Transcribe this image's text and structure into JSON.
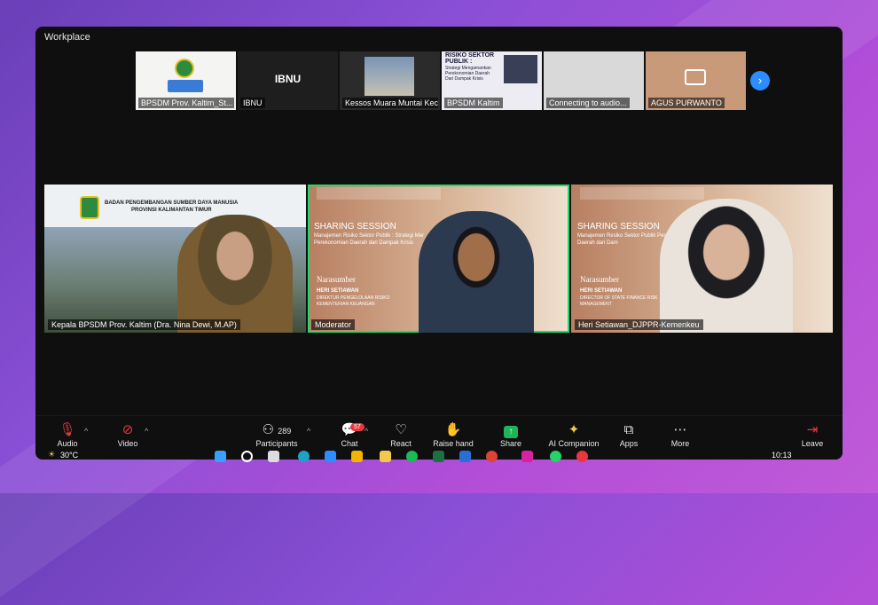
{
  "window": {
    "title": "Workplace",
    "status_right": ""
  },
  "thumbnails": [
    {
      "name": "BPSDM Prov. Kaltim_St...",
      "center_label": ""
    },
    {
      "name": "IBNU",
      "center_label": "IBNU"
    },
    {
      "name": "Kessos Muara Muntai Kec...",
      "center_label": ""
    },
    {
      "name": "BPSDM Kaltim",
      "center_label": ""
    },
    {
      "name": "Connecting to audio...",
      "center_label": ""
    },
    {
      "name": "AGUS PURWANTO",
      "center_label": ""
    }
  ],
  "thumb_slide": {
    "heading": "RISIKO SEKTOR PUBLIK :",
    "sub": "Strategi Mengamankan Perekonomian Daerah Dari Dampak Krisis"
  },
  "tiles": [
    {
      "name": "Kepala BPSDM Prov. Kaltim (Dra. Nina Dewi, M.AP)",
      "banner1": "BADAN PENGEMBANGAN SUMBER DAYA MANUSIA",
      "banner2": "PROVINSI KALIMANTAN TIMUR"
    },
    {
      "name": "Moderator",
      "session": "SHARING SESSION",
      "topic": "Manajemen Risiko Sektor Publik : Strategi Mer Perekonomian Daerah dari Dampak Krisis",
      "speaker_heading": "Narasumber",
      "speaker_name": "HERI SETIAWAN",
      "speaker_role": "DIREKTUR PENGELOLAAN RISIKO KEMENTERIAN KEUANGAN"
    },
    {
      "name": "Heri Setiawan_DJPPR-Kemenkeu",
      "session": "SHARING SESSION",
      "topic": "Manajemen Resiko Sektor Publik Perekonomian Daerah dari Dam",
      "speaker_heading": "Narasumber",
      "speaker_name": "HERI SETIAWAN",
      "speaker_role": "DIRECTOR OF STATE FINANCE RISK MANAGEMENT"
    }
  ],
  "toolbar": {
    "audio": "Audio",
    "video": "Video",
    "participants": "Participants",
    "participants_count": "289",
    "chat": "Chat",
    "chat_badge": "57",
    "react": "React",
    "raise_hand": "Raise hand",
    "share": "Share",
    "ai_companion": "AI Companion",
    "apps": "Apps",
    "more": "More",
    "leave": "Leave"
  },
  "taskbar": {
    "weather": "30°C",
    "time": "10:13"
  },
  "colors": {
    "accent": "#2d8cff",
    "active_speaker": "#23d96b",
    "share_green": "#1fb35a",
    "leave_red": "#e8383f"
  }
}
